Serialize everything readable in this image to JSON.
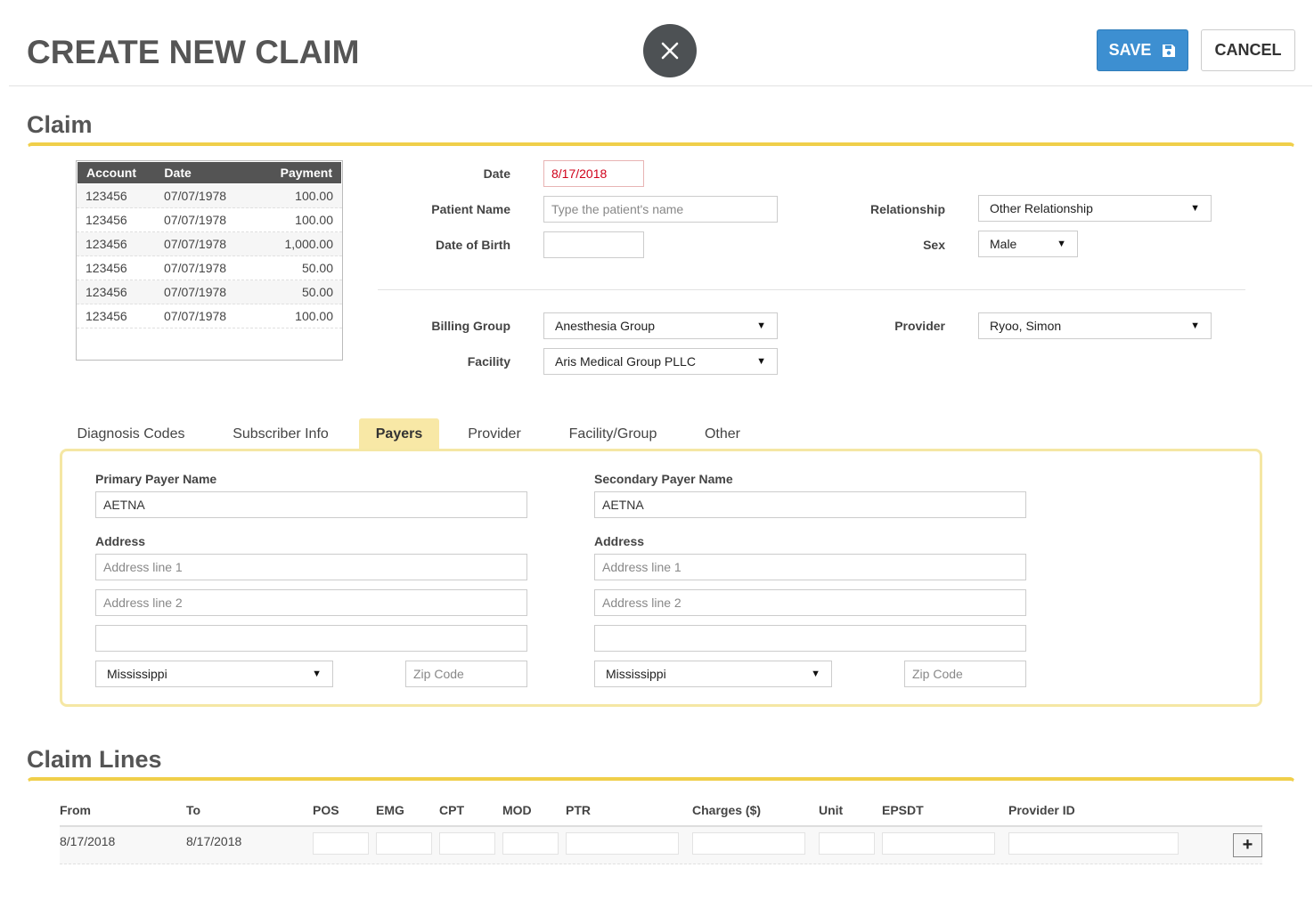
{
  "header": {
    "title": "CREATE NEW CLAIM",
    "save_label": "SAVE",
    "cancel_label": "CANCEL"
  },
  "claim_section": {
    "title": "Claim",
    "accounts_table": {
      "columns": [
        "Account",
        "Date",
        "Payment"
      ],
      "rows": [
        [
          "123456",
          "07/07/1978",
          "100.00"
        ],
        [
          "123456",
          "07/07/1978",
          "100.00"
        ],
        [
          "123456",
          "07/07/1978",
          "1,000.00"
        ],
        [
          "123456",
          "07/07/1978",
          "50.00"
        ],
        [
          "123456",
          "07/07/1978",
          "50.00"
        ],
        [
          "123456",
          "07/07/1978",
          "100.00"
        ]
      ]
    },
    "form": {
      "date_label": "Date",
      "date_value": "8/17/2018",
      "date_color": "#d0021b",
      "patient_name_label": "Patient Name",
      "patient_name_placeholder": "Type the patient's name",
      "dob_label": "Date of Birth",
      "dob_value": "",
      "relationship_label": "Relationship",
      "relationship_value": "Other Relationship",
      "sex_label": "Sex",
      "sex_value": "Male",
      "billing_group_label": "Billing Group",
      "billing_group_value": "Anesthesia Group",
      "facility_label": "Facility",
      "facility_value": "Aris Medical Group PLLC",
      "provider_label": "Provider",
      "provider_value": "Ryoo, Simon"
    }
  },
  "tabs": [
    {
      "label": "Diagnosis Codes",
      "active": false
    },
    {
      "label": "Subscriber Info",
      "active": false
    },
    {
      "label": "Payers",
      "active": true
    },
    {
      "label": "Provider",
      "active": false
    },
    {
      "label": "Facility/Group",
      "active": false
    },
    {
      "label": "Other",
      "active": false
    }
  ],
  "payers": {
    "primary": {
      "name_label": "Primary Payer Name",
      "name_value": "AETNA",
      "address_label": "Address",
      "address1_placeholder": "Address line 1",
      "address2_placeholder": "Address line 2",
      "city_value": "",
      "state_value": "Mississippi",
      "zip_placeholder": "Zip Code"
    },
    "secondary": {
      "name_label": "Secondary Payer Name",
      "name_value": "AETNA",
      "address_label": "Address",
      "address1_placeholder": "Address line 1",
      "address2_placeholder": "Address line 2",
      "city_value": "",
      "state_value": "Mississippi",
      "zip_placeholder": "Zip Code"
    }
  },
  "claim_lines": {
    "title": "Claim Lines",
    "columns": [
      "From",
      "To",
      "POS",
      "EMG",
      "CPT",
      "MOD",
      "PTR",
      "Charges ($)",
      "Unit",
      "EPSDT",
      "Provider ID"
    ],
    "rows": [
      {
        "from": "8/17/2018",
        "to": "8/17/2018"
      }
    ],
    "add_label": "+"
  },
  "colors": {
    "accent_yellow": "#f0cf4a",
    "save_blue": "#3d8fd1",
    "close_dark": "#4d5154"
  }
}
